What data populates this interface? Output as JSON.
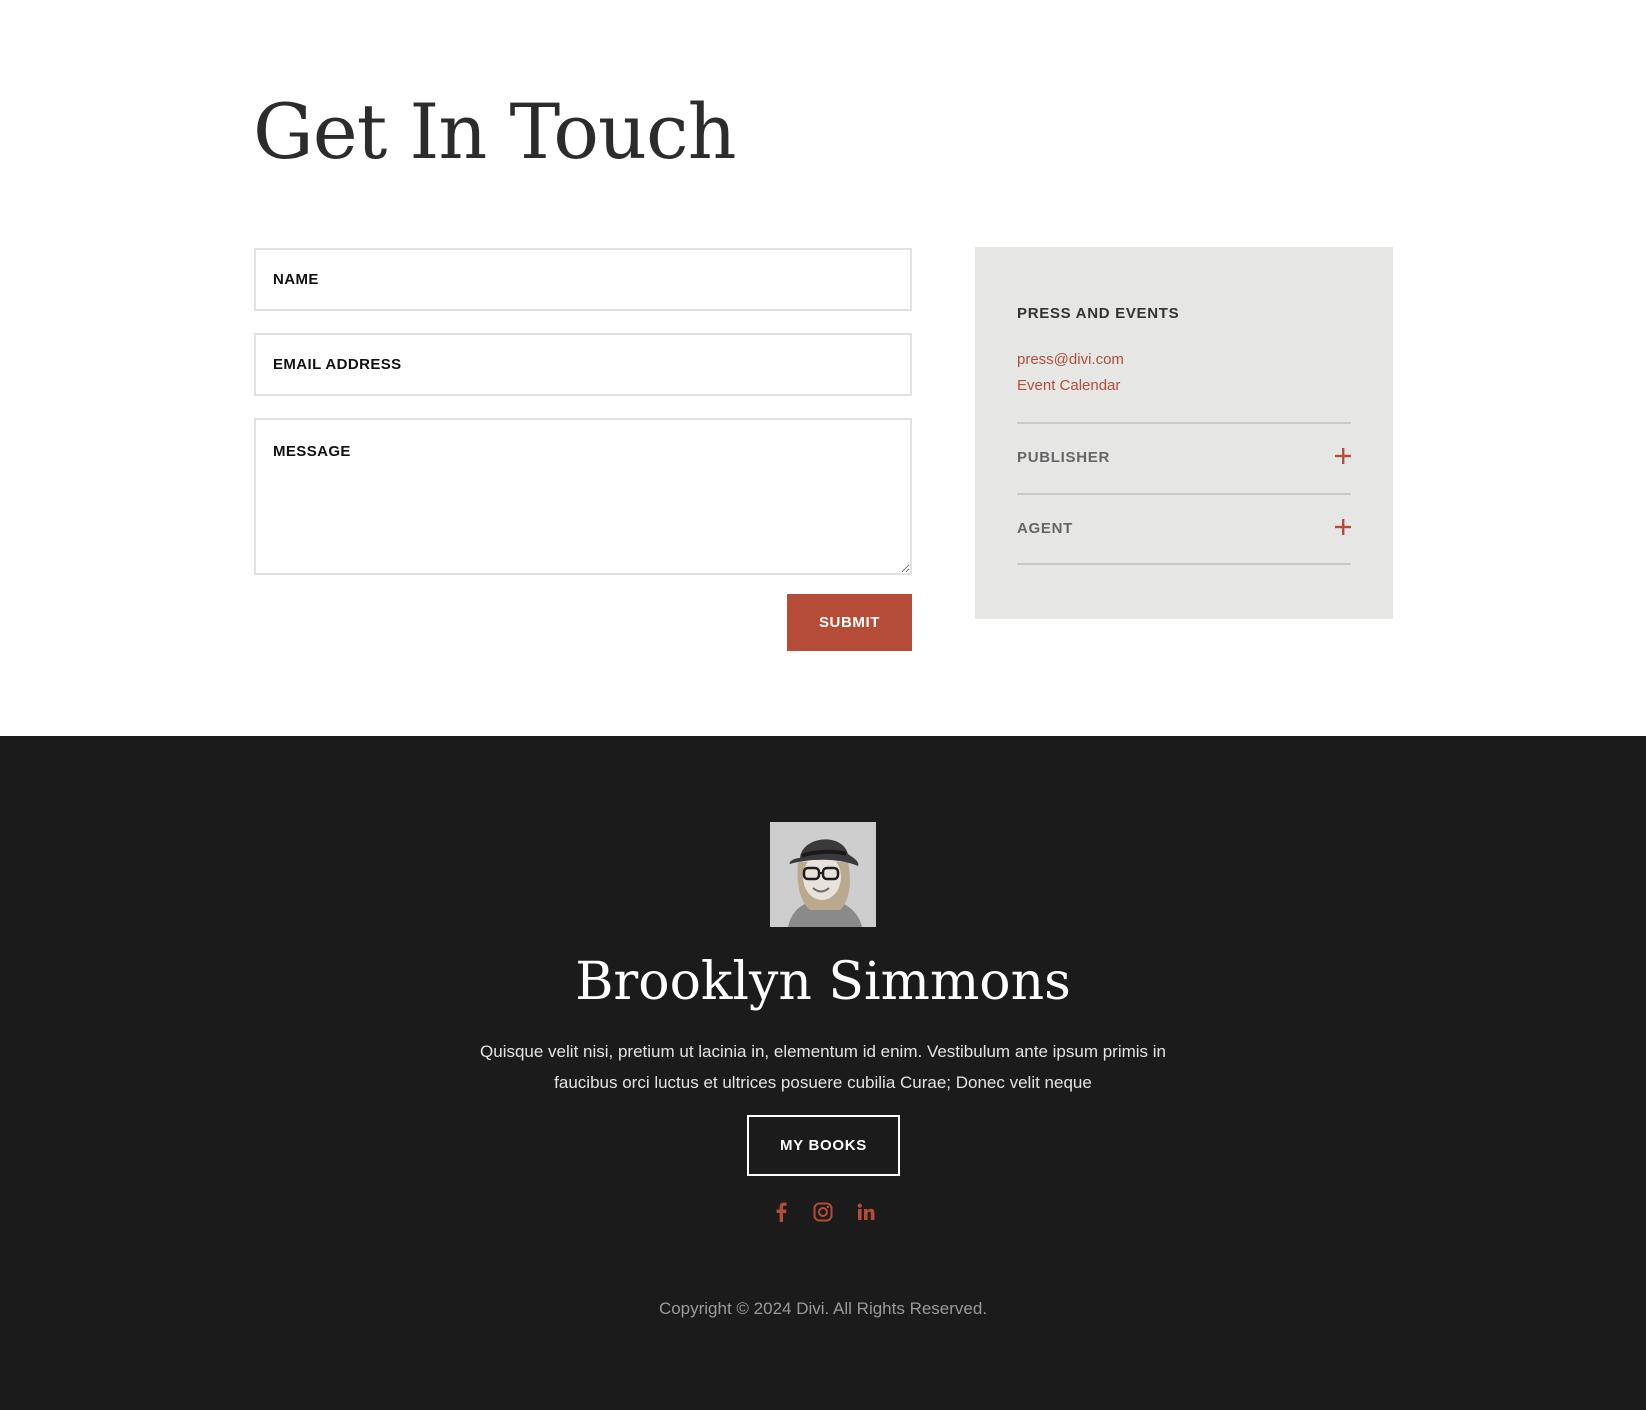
{
  "contact": {
    "title": "Get In Touch",
    "form": {
      "name_placeholder": "NAME",
      "email_placeholder": "EMAIL ADDRESS",
      "message_placeholder": "MESSAGE",
      "submit_label": "SUBMIT"
    },
    "panel": {
      "heading": "PRESS AND EVENTS",
      "links": [
        "press@divi.com",
        "Event Calendar"
      ],
      "toggles": [
        {
          "label": "PUBLISHER",
          "icon": "plus-icon"
        },
        {
          "label": "AGENT",
          "icon": "plus-icon"
        }
      ]
    }
  },
  "footer": {
    "author_name": "Brooklyn Simmons",
    "bio": "Quisque velit nisi, pretium ut lacinia in, elementum id enim. Vestibulum ante ipsum primis in faucibus orci luctus et ultrices posuere cubilia Curae; Donec velit neque",
    "books_label": "MY BOOKS",
    "social_icons": [
      "facebook-icon",
      "instagram-icon",
      "linkedin-icon"
    ],
    "copyright": "Copyright © 2024 Divi. All Rights Reserved."
  },
  "colors": {
    "accent": "#b44c38",
    "panel_bg": "#e6e7e5",
    "footer_bg": "#1b1b1b"
  }
}
